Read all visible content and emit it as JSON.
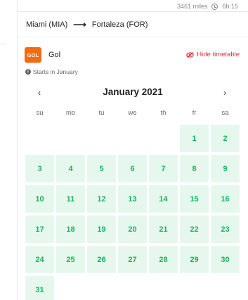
{
  "header": {
    "distance": "3461 miles",
    "duration": "6h 15"
  },
  "route": {
    "origin": "Miami (MIA)",
    "arrow": "⟶",
    "destination": "Fortaleza (FOR)"
  },
  "airline": {
    "logo_text": "GOL",
    "name": "Gol",
    "hide_timetable_label": "Hide timetable",
    "starts_text": "Starts in January"
  },
  "calendar": {
    "month_title": "January 2021",
    "prev_label": "‹",
    "next_label": "›",
    "weekdays": [
      "su",
      "mo",
      "tu",
      "we",
      "th",
      "fr",
      "sa"
    ],
    "leading_blanks": 5,
    "days": [
      "1",
      "2",
      "3",
      "4",
      "5",
      "6",
      "7",
      "8",
      "9",
      "10",
      "11",
      "12",
      "13",
      "14",
      "15",
      "16",
      "17",
      "18",
      "19",
      "20",
      "21",
      "22",
      "23",
      "24",
      "25",
      "26",
      "27",
      "28",
      "29",
      "30",
      "31"
    ]
  },
  "colors": {
    "accent_green": "#16b45c",
    "day_background": "#e6f8ee",
    "hide_red": "#e0303a",
    "logo_orange": "#f26b13"
  },
  "icons": {
    "clock": "clock-icon",
    "eye": "eye-off-icon",
    "info": "info-icon",
    "prev": "chevron-left-icon",
    "next": "chevron-right-icon"
  }
}
